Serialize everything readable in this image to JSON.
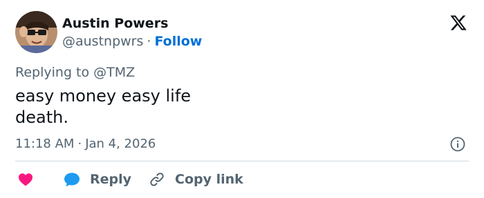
{
  "author": {
    "name": "Austin Powers",
    "handle": "@austnpwrs",
    "separator": "·",
    "follow_label": "Follow"
  },
  "reply_context": {
    "text": "Replying to @TMZ"
  },
  "tweet": {
    "lines": [
      "easy money easy life",
      "death."
    ]
  },
  "meta": {
    "time": "11:18 AM",
    "separator": "·",
    "date": "Jan 4, 2026"
  },
  "actions": {
    "reply_label": "Reply",
    "copy_label": "Copy link"
  },
  "icons": {
    "brand": "x-logo-icon",
    "info": "info-icon",
    "like": "heart-icon",
    "reply": "speech-bubble-icon",
    "copy": "link-icon"
  },
  "colors": {
    "text": "#0f1419",
    "secondary": "#536471",
    "follow": "#006fd6",
    "heart": "#f91880",
    "reply_bubble": "#1d9bf0",
    "divider": "#cfd9de"
  }
}
